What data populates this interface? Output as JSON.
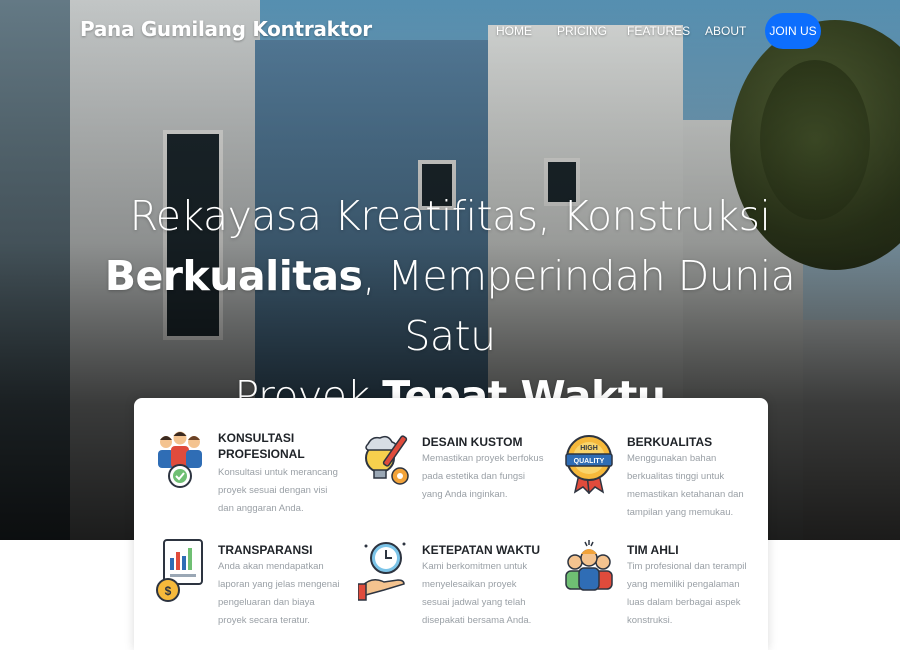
{
  "navbar": {
    "brand": "Pana Gumilang Kontraktor",
    "items": [
      "HOME",
      "PRICING",
      "FEATURES",
      "ABOUT"
    ],
    "cta": "JOIN US",
    "cta_color": "#0d6efd"
  },
  "hero": {
    "line1": "Rekayasa Kreatifitas, Konstruksi",
    "line2_bold": "Berkualitas",
    "line2_rest": ", Memperindah Dunia Satu",
    "line3_light": "Proyek ",
    "line3_bold": "Tepat Waktu"
  },
  "features": [
    {
      "icon": "consultant-team-icon",
      "title": "KONSULTASI PROFESIONAL",
      "desc": "Konsultasi untuk merancang proyek sesuai dengan visi dan anggaran Anda."
    },
    {
      "icon": "creative-design-icon",
      "title": "DESAIN KUSTOM",
      "desc": "Memastikan proyek berfokus pada estetika dan fungsi yang Anda inginkan."
    },
    {
      "icon": "high-quality-badge-icon",
      "title": "BERKUALITAS",
      "desc": "Menggunakan bahan berkualitas tinggi untuk memastikan ketahanan dan tampilan yang memukau."
    },
    {
      "icon": "financial-report-icon",
      "title": "TRANSPARANSI",
      "desc": "Anda akan mendapatkan laporan yang jelas mengenai pengeluaran dan biaya proyek secara teratur."
    },
    {
      "icon": "clock-hand-icon",
      "title": "KETEPATAN WAKTU",
      "desc": "Kami berkomitmen untuk menyelesaikan proyek sesuai jadwal yang telah disepakati bersama Anda."
    },
    {
      "icon": "team-group-icon",
      "title": "TIM AHLI",
      "desc": "Tim profesional dan terampil yang memiliki pengalaman luas dalam berbagai aspek konstruksi."
    }
  ]
}
